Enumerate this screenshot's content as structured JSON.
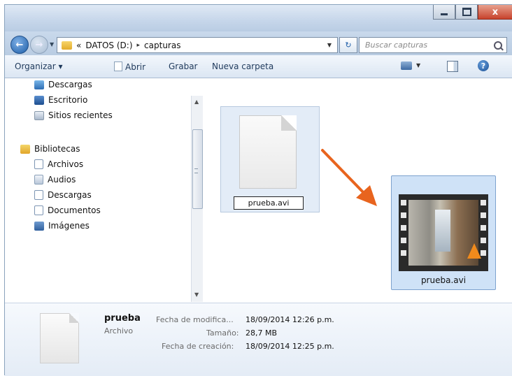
{
  "window": {
    "close_glyph": "x"
  },
  "address": {
    "prefix": "«",
    "segments": [
      "DATOS (D:)",
      "capturas"
    ],
    "separator": "▸"
  },
  "search": {
    "placeholder": "Buscar capturas"
  },
  "toolbar": {
    "organize": "Organizar ▾",
    "open": "Abrir",
    "burn": "Grabar",
    "new_folder": "Nueva carpeta"
  },
  "nav": {
    "items": [
      {
        "label": "Descargas",
        "icon": "downloads-icon"
      },
      {
        "label": "Escritorio",
        "icon": "desktop-icon"
      },
      {
        "label": "Sitios recientes",
        "icon": "recent-places-icon"
      },
      {
        "label": "Bibliotecas",
        "icon": "libraries-icon"
      },
      {
        "label": "Archivos",
        "icon": "document-library-icon"
      },
      {
        "label": "Audios",
        "icon": "music-library-icon"
      },
      {
        "label": "Descargas",
        "icon": "downloads-library-icon"
      },
      {
        "label": "Documentos",
        "icon": "documents-library-icon"
      },
      {
        "label": "Imágenes",
        "icon": "pictures-library-icon"
      }
    ]
  },
  "content": {
    "renaming_file": "prueba.avi",
    "result_file": "prueba.avi"
  },
  "details": {
    "name": "prueba",
    "type": "Archivo",
    "modified_label": "Fecha de modifica...",
    "modified_value": "18/09/2014 12:26 p.m.",
    "size_label": "Tamaño:",
    "size_value": "28,7 MB",
    "created_label": "Fecha de creación:",
    "created_value": "18/09/2014 12:25 p.m."
  },
  "colors": {
    "arrow": "#e8641e",
    "selection": "#cfe2f7",
    "close_button": "#c7422c"
  }
}
